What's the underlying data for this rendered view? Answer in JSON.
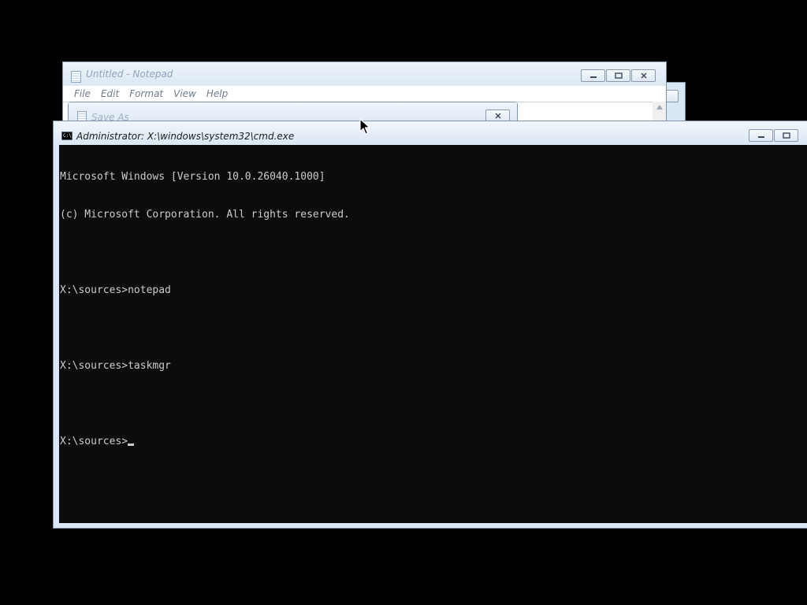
{
  "notepad": {
    "title": "Untitled - Notepad",
    "menu": [
      "File",
      "Edit",
      "Format",
      "View",
      "Help"
    ],
    "controls": [
      "minimize-icon",
      "maximize-icon",
      "close-icon"
    ]
  },
  "save_as": {
    "title": "Save As"
  },
  "cmd": {
    "title": "Administrator: X:\\windows\\system32\\cmd.exe",
    "icon_text": "C:\\",
    "controls": [
      "minimize-icon",
      "maximize-icon",
      "close-icon"
    ],
    "lines": [
      "Microsoft Windows [Version 10.0.26040.1000]",
      "(c) Microsoft Corporation. All rights reserved.",
      "",
      "X:\\sources>notepad",
      "",
      "X:\\sources>taskmgr",
      "",
      "X:\\sources>"
    ]
  },
  "colors": {
    "console_bg": "#0c0c0c",
    "console_fg": "#cccccc",
    "frame": "#d9e6f3",
    "desktop": "#000000"
  }
}
